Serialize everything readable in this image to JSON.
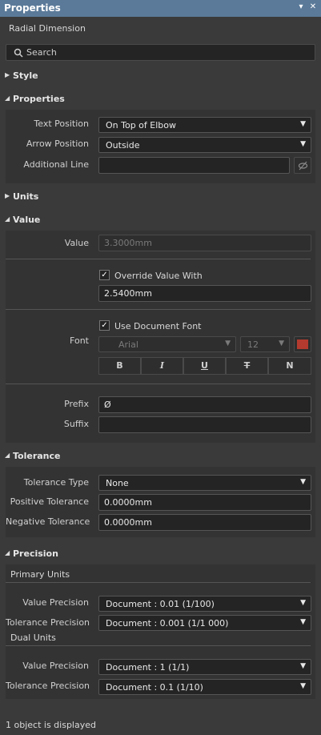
{
  "titlebar": {
    "title": "Properties",
    "pin_glyph": "▾",
    "close_glyph": "✕"
  },
  "object_type": "Radial Dimension",
  "search": {
    "placeholder": "Search"
  },
  "sections": {
    "style": "Style",
    "properties": "Properties",
    "units": "Units",
    "value": "Value",
    "tolerance": "Tolerance",
    "precision": "Precision"
  },
  "properties": {
    "text_position_label": "Text Position",
    "text_position_value": "On Top of Elbow",
    "arrow_position_label": "Arrow Position",
    "arrow_position_value": "Outside",
    "additional_line_label": "Additional Line",
    "additional_line_value": ""
  },
  "value": {
    "value_label": "Value",
    "value_value": "3.3000mm",
    "override_label": "Override Value With",
    "override_checked": true,
    "override_value": "2.5400mm",
    "font_label": "Font",
    "use_doc_font_label": "Use Document Font",
    "use_doc_font_checked": true,
    "font_family": "Arial",
    "font_size": "12",
    "font_color": "#b33a2e",
    "format_buttons": [
      "B",
      "I",
      "U",
      "T",
      "N"
    ],
    "prefix_label": "Prefix",
    "prefix_value": "Ø",
    "suffix_label": "Suffix",
    "suffix_value": ""
  },
  "tolerance": {
    "type_label": "Tolerance Type",
    "type_value": "None",
    "positive_label": "Positive Tolerance",
    "positive_value": "0.0000mm",
    "negative_label": "Negative Tolerance",
    "negative_value": "0.0000mm"
  },
  "precision": {
    "primary_units": "Primary Units",
    "primary_value_label": "Value Precision",
    "primary_value_value": "Document : 0.01 (1/100)",
    "primary_tol_label": "Tolerance Precision",
    "primary_tol_value": "Document : 0.001 (1/1 000)",
    "dual_units": "Dual Units",
    "dual_value_label": "Value Precision",
    "dual_value_value": "Document : 1 (1/1)",
    "dual_tol_label": "Tolerance Precision",
    "dual_tol_value": "Document : 0.1 (1/10)"
  },
  "status": "1 object is displayed"
}
